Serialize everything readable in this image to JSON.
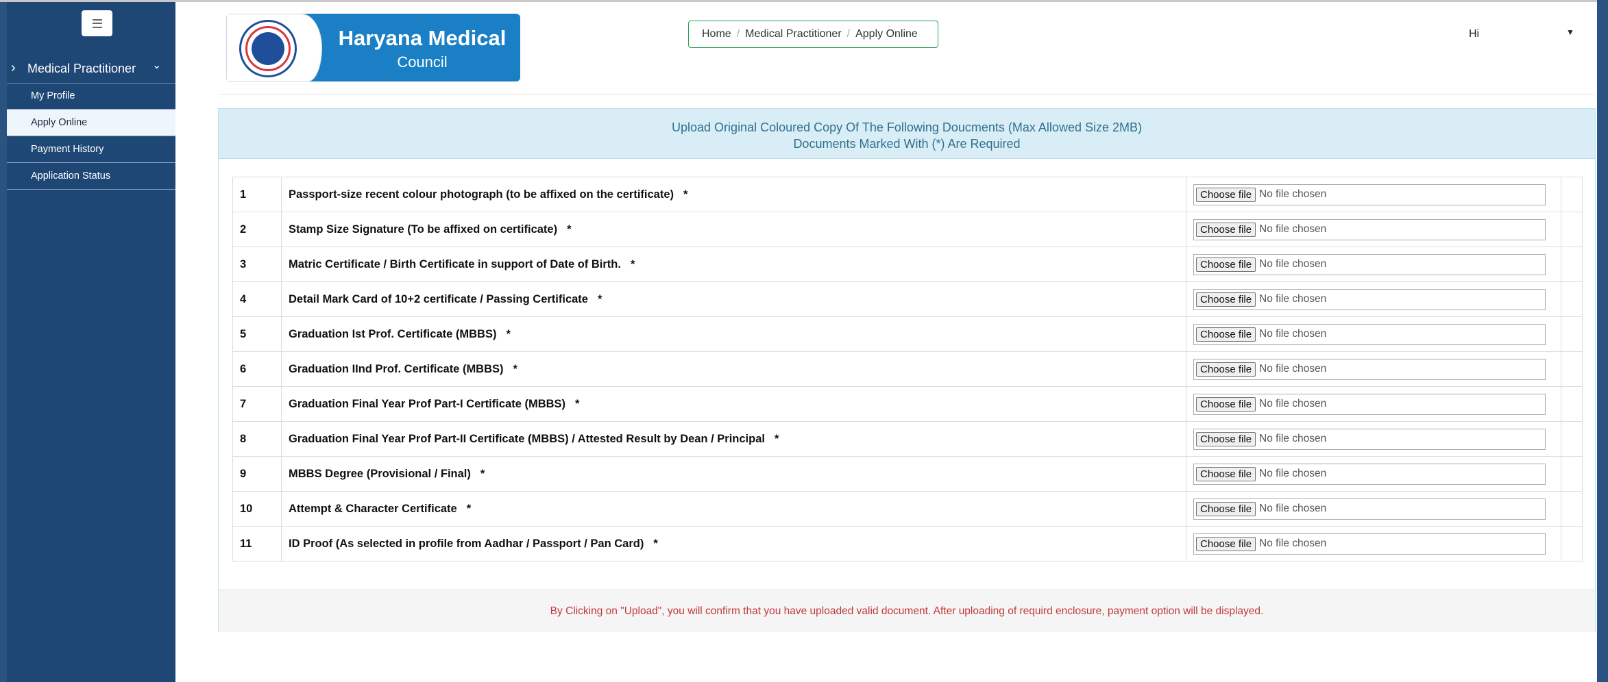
{
  "sidebar": {
    "section_label": "Medical Practitioner",
    "items": [
      {
        "label": "My Profile"
      },
      {
        "label": "Apply Online"
      },
      {
        "label": "Payment History"
      },
      {
        "label": "Application Status"
      }
    ]
  },
  "header": {
    "logo_line1": "Haryana Medical",
    "logo_line2": "Council",
    "logo_seal_text": "HARYANA MEDICAL COUNCIL",
    "breadcrumb": [
      "Home",
      "Medical Practitioner",
      "Apply Online"
    ],
    "greeting": "Hi"
  },
  "panel": {
    "heading_line1": "Upload Original Coloured Copy Of The Following Doucments (Max Allowed Size 2MB)",
    "heading_line2": "Documents Marked With (*) Are Required",
    "file_button_label": "Choose file",
    "no_file_text": "No file chosen",
    "required_mark": "*",
    "documents": [
      {
        "no": "1",
        "title": "Passport-size recent colour photograph (to be affixed on the certificate)"
      },
      {
        "no": "2",
        "title": "Stamp Size Signature (To be affixed on certificate)"
      },
      {
        "no": "3",
        "title": "Matric Certificate / Birth Certificate in support of Date of Birth."
      },
      {
        "no": "4",
        "title": "Detail Mark Card of 10+2 certificate / Passing Certificate"
      },
      {
        "no": "5",
        "title": "Graduation Ist Prof. Certificate (MBBS)"
      },
      {
        "no": "6",
        "title": "Graduation IInd Prof. Certificate (MBBS)"
      },
      {
        "no": "7",
        "title": "Graduation Final Year Prof Part-I Certificate (MBBS)"
      },
      {
        "no": "8",
        "title": "Graduation Final Year Prof Part-II Certificate (MBBS) / Attested Result by Dean / Principal"
      },
      {
        "no": "9",
        "title": "MBBS Degree (Provisional / Final)"
      },
      {
        "no": "10",
        "title": "Attempt & Character Certificate"
      },
      {
        "no": "11",
        "title": "ID Proof (As selected in profile from Aadhar / Passport / Pan Card)"
      }
    ],
    "footer_note": "By Clicking on \"Upload\", you will confirm that you have uploaded valid document. After uploading of requird enclosure, payment option will be displayed."
  },
  "colors": {
    "sidebar_bg": "#1f4775",
    "logo_bg": "#1a7fc4",
    "panel_heading_bg": "#d9edf7",
    "panel_heading_text": "#31708f",
    "footer_note_text": "#c1383a",
    "breadcrumb_border": "#2e9f5b"
  }
}
